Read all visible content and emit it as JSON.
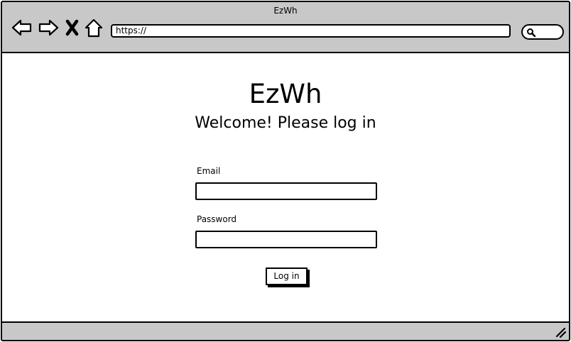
{
  "window": {
    "title": "EzWh"
  },
  "browser": {
    "url": "https://",
    "icons": [
      "back-arrow-icon",
      "forward-arrow-icon",
      "close-x-icon",
      "home-icon",
      "search-icon",
      "resize-grip-icon"
    ]
  },
  "page": {
    "app_title": "EzWh",
    "welcome": "Welcome! Please log in"
  },
  "form": {
    "email_label": "Email",
    "email_value": "",
    "password_label": "Password",
    "password_value": "",
    "login_label": "Log in"
  },
  "colors": {
    "chrome": "#c8c8c8",
    "ink": "#000000",
    "background": "#ffffff"
  }
}
